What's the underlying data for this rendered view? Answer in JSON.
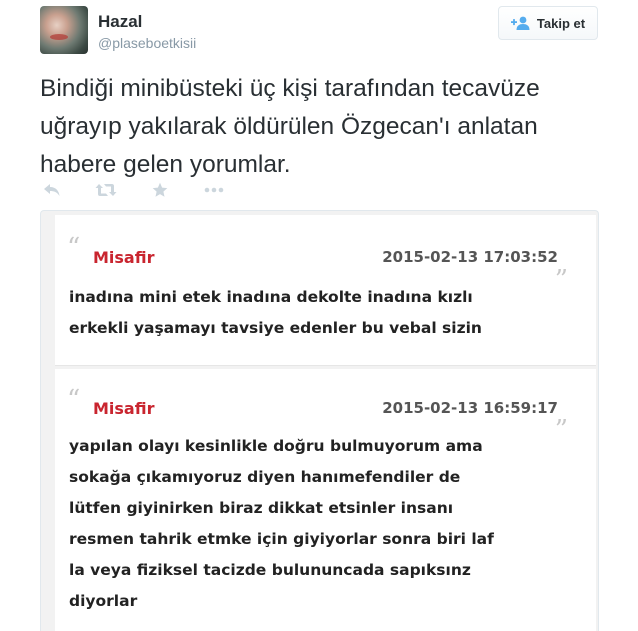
{
  "user": {
    "name": "Hazal",
    "handle": "@plaseboetkisii"
  },
  "follow_button": {
    "label": "Takip et",
    "icon": "add-user-icon"
  },
  "tweet": {
    "text": "Bindiği minibüsteki üç kişi tarafından tecavüze uğrayıp yakılarak öldürülen Özgecan'ı anlatan habere gelen yorumlar."
  },
  "actions": [
    {
      "name": "reply",
      "icon": "reply-icon"
    },
    {
      "name": "retweet",
      "icon": "retweet-icon"
    },
    {
      "name": "favorite",
      "icon": "star-icon"
    },
    {
      "name": "more",
      "icon": "more-icon"
    }
  ],
  "comments": [
    {
      "author": "Misafir",
      "date": "2015-02-13 17:03:52",
      "lines": [
        "inadına mini etek inadına dekolte inadına kızlı",
        "erkekli yaşamayı tavsiye edenler bu vebal sizin"
      ]
    },
    {
      "author": "Misafir",
      "date": "2015-02-13 16:59:17",
      "lines": [
        "yapılan olayı kesinlikle doğru bulmuyorum ama",
        "sokağa çıkamıyoruz diyen hanımefendiler de",
        "lütfen giyinirken biraz dikkat etsinler insanı",
        "resmen tahrik etmke için giyiyorlar sonra biri laf",
        "la veya fiziksel tacizde bulununcada sapıksınz",
        "diyorlar"
      ]
    }
  ],
  "colors": {
    "author": "#c9252f",
    "action_icon": "#ccd6dd",
    "text": "#292f33",
    "handle": "#8899a6"
  }
}
